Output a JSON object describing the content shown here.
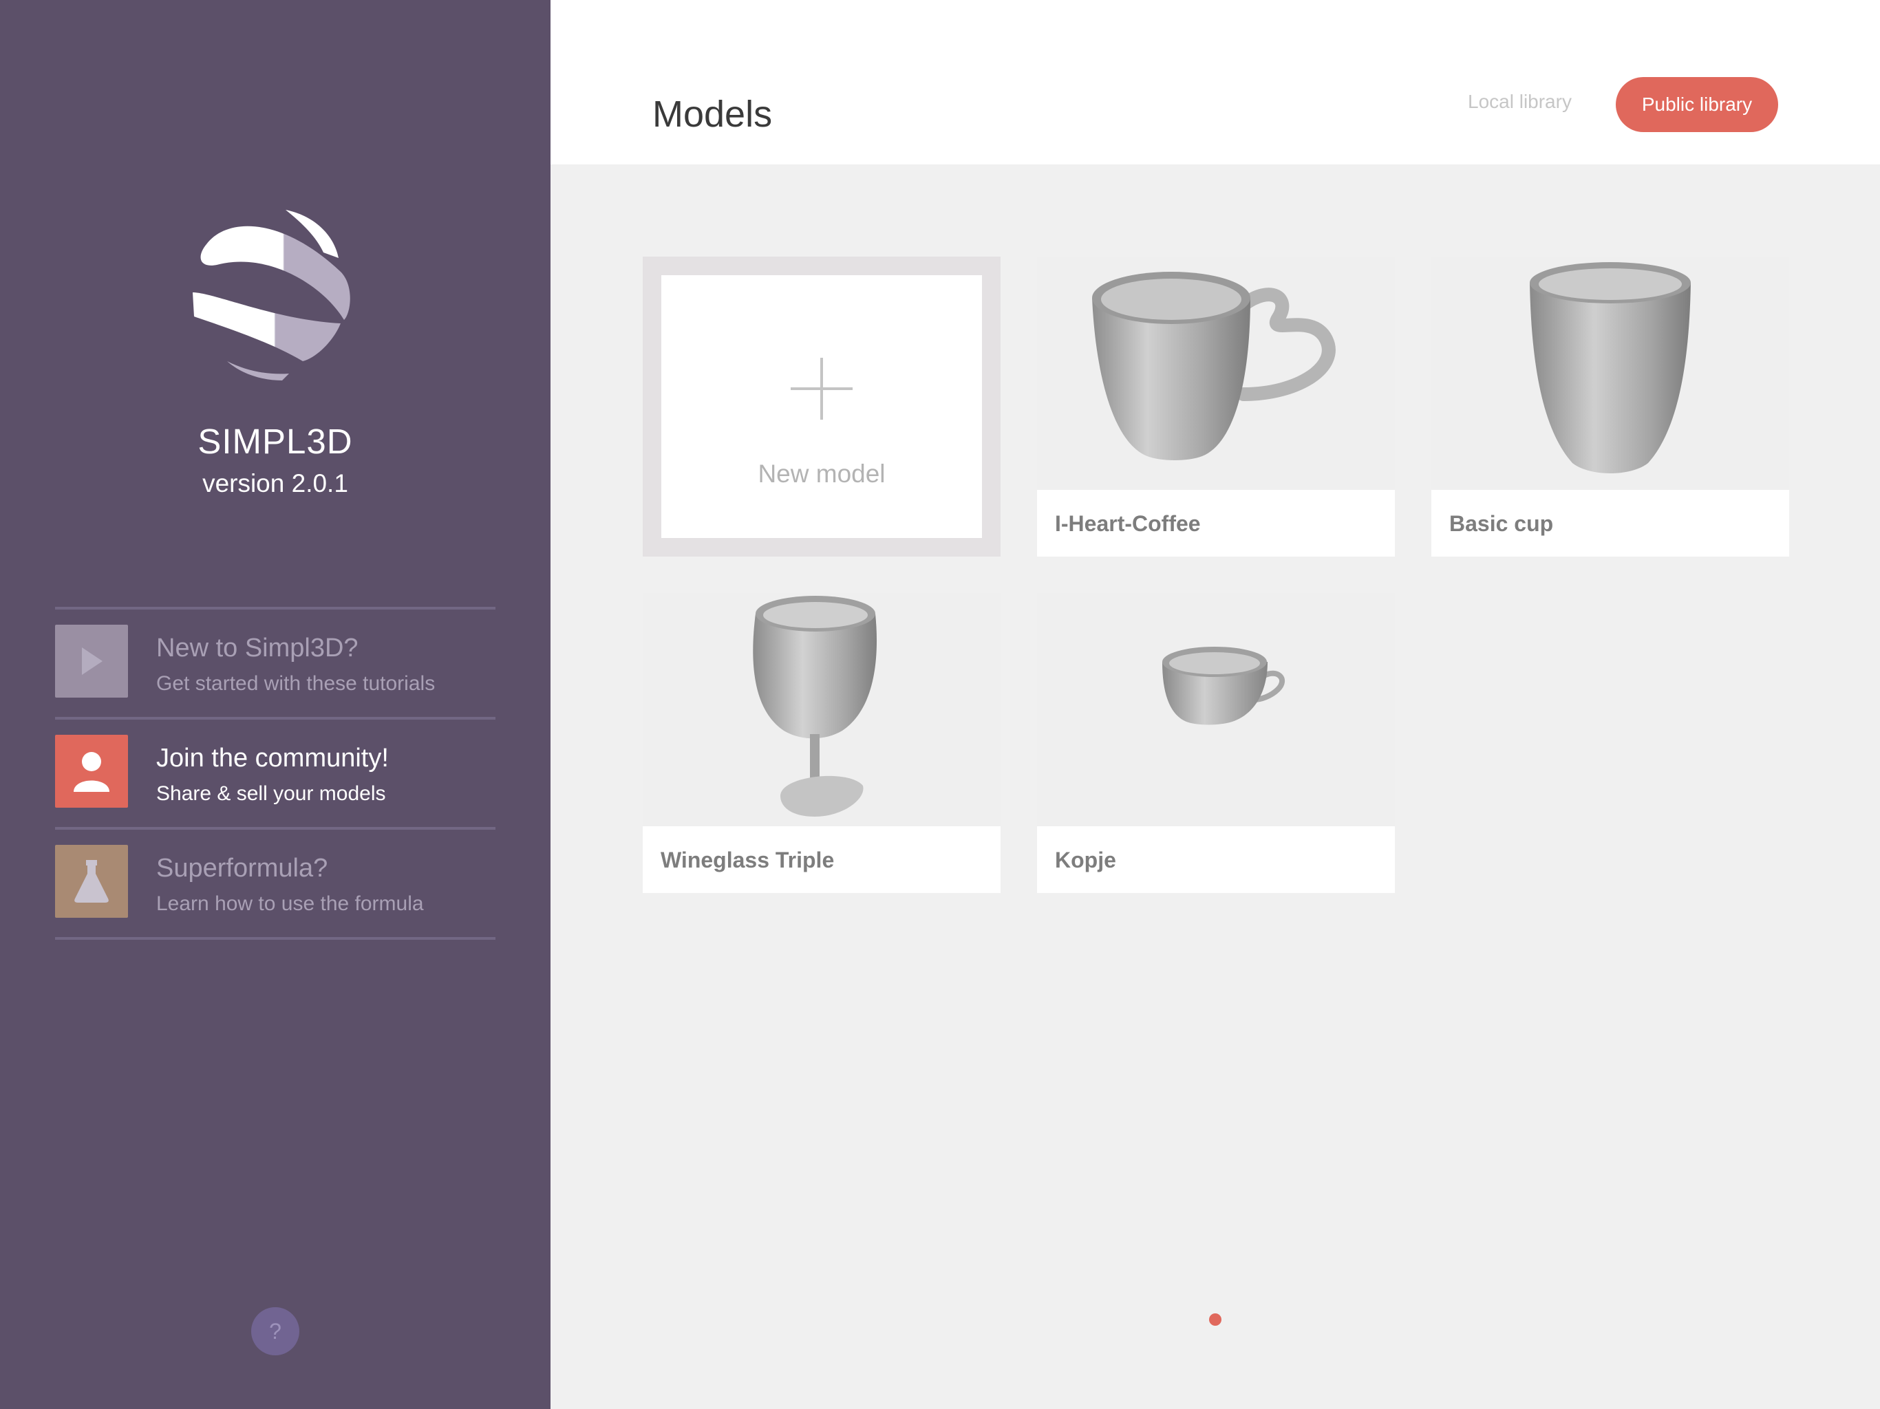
{
  "app": {
    "name": "SIMPL3D",
    "version": "version 2.0.1"
  },
  "sidebar": {
    "items": [
      {
        "title": "New to Simpl3D?",
        "subtitle": "Get started with these tutorials",
        "icon": "play-icon",
        "color": "#9a8fa3"
      },
      {
        "title": "Join the community!",
        "subtitle": "Share & sell your models",
        "icon": "person-icon",
        "color": "#e0685c"
      },
      {
        "title": "Superformula?",
        "subtitle": "Learn how to use the formula",
        "icon": "flask-icon",
        "color": "#a98a73"
      }
    ],
    "help_label": "?"
  },
  "header": {
    "title": "Models",
    "tabs": {
      "local": "Local library",
      "public": "Public library"
    },
    "active_tab": "Public library"
  },
  "models": {
    "new_label": "New model",
    "cards": [
      {
        "name": "I-Heart-Coffee",
        "icon": "mug-heart-handle-icon"
      },
      {
        "name": "Basic cup",
        "icon": "cup-icon"
      },
      {
        "name": "Wineglass Triple",
        "icon": "wineglass-icon"
      },
      {
        "name": "Kopje",
        "icon": "teacup-icon"
      }
    ]
  },
  "pagination": {
    "pages": 1,
    "current": 1
  },
  "colors": {
    "sidebar": "#5c5069",
    "accent": "#e0685c",
    "background": "#f0f0f0"
  }
}
